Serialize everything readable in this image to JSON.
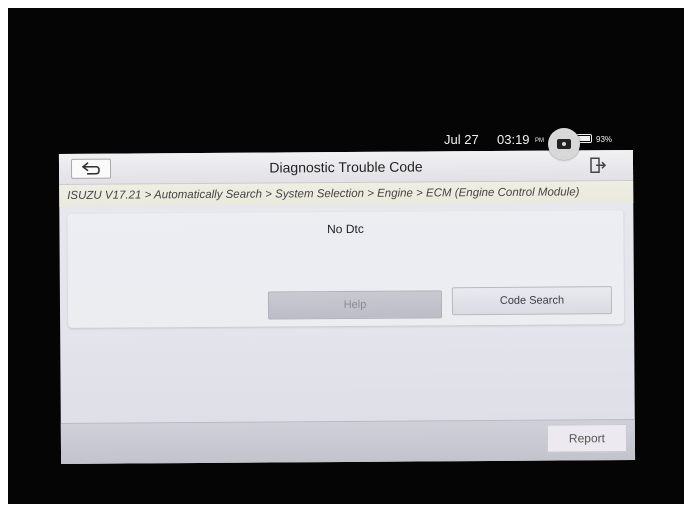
{
  "status": {
    "date": "Jul 27",
    "time": "03:19",
    "ampm": "PM",
    "battery": "93%"
  },
  "window": {
    "title": "Diagnostic Trouble Code",
    "breadcrumb": "ISUZU V17.21 > Automatically Search > System Selection > Engine > ECM (Engine Control Module)"
  },
  "dtc": {
    "message": "No Dtc",
    "help_label": "Help",
    "code_search_label": "Code Search"
  },
  "toolbar": {
    "report_label": "Report"
  },
  "icons": {
    "back": "back-arrow-icon",
    "exit": "exit-icon",
    "camera": "camera-icon",
    "battery": "battery-icon"
  }
}
